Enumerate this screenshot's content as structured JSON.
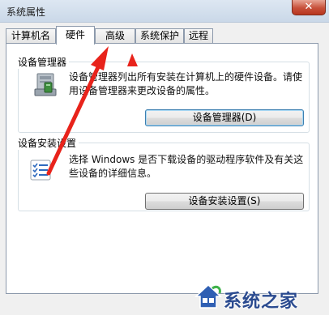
{
  "window": {
    "title": "系统属性",
    "close_label": "✕"
  },
  "tabs": [
    {
      "label": "计算机名",
      "active": false
    },
    {
      "label": "硬件",
      "active": true
    },
    {
      "label": "高级",
      "active": false
    },
    {
      "label": "系统保护",
      "active": false
    },
    {
      "label": "远程",
      "active": false
    }
  ],
  "device_manager": {
    "title": "设备管理器",
    "description_line1": "设备管理器列出所有安装在计算机上的硬件设备。请使",
    "description_line2": "用设备管理器来更改设备的属性。",
    "button_label": "设备管理器(D)",
    "icon": "device-manager-icon"
  },
  "device_install": {
    "title": "设备安装设置",
    "description_line1": "选择 Windows 是否下载设备的驱动程序软件及有关这",
    "description_line2": "些设备的详细信息。",
    "button_label": "设备安装设置(S)",
    "icon": "checklist-icon"
  },
  "watermark": {
    "text": "系统之家"
  },
  "colors": {
    "arrow": "#e8231b",
    "selection": "#3c7fb1"
  }
}
